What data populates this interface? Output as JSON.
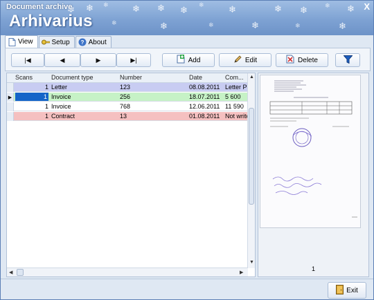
{
  "window": {
    "title": "Document archive",
    "close_glyph": "X",
    "app_name": "Arhivarius"
  },
  "tabs": [
    {
      "label": "View",
      "icon": "document-icon",
      "active": true
    },
    {
      "label": "Setup",
      "icon": "key-icon",
      "active": false
    },
    {
      "label": "About",
      "icon": "help-icon",
      "active": false
    }
  ],
  "toolbar": {
    "nav": {
      "first": "◀◀",
      "prev": "◀",
      "next": "▶",
      "last": "▶▶"
    },
    "add_label": "Add",
    "edit_label": "Edit",
    "delete_label": "Delete"
  },
  "grid": {
    "columns": [
      "Scans",
      "Document type",
      "Number",
      "Date",
      "Com..."
    ],
    "rows": [
      {
        "scans": "1",
        "type": "Letter",
        "number": "123",
        "date": "08.08.2011",
        "comment": "Letter Pi",
        "color": "#c8ccf2",
        "current": false
      },
      {
        "scans": "1",
        "type": "Invoice",
        "number": "256",
        "date": "18.07.2011",
        "comment": "5 600",
        "color": "#c6f2c6",
        "current": true
      },
      {
        "scans": "1",
        "type": "Invoice",
        "number": "768",
        "date": "12.06.2011",
        "comment": "11 590",
        "color": "#ffffff",
        "current": false
      },
      {
        "scans": "1",
        "type": "Contract",
        "number": "13",
        "date": "01.08.2011",
        "comment": "Not write",
        "color": "#f5c0c0",
        "current": false
      }
    ],
    "current_indicator": "▶"
  },
  "preview": {
    "page_number": "1"
  },
  "footer": {
    "exit_label": "Exit"
  },
  "colors": {
    "accent": "#1e5fbf",
    "selected_cell": "#1565c8"
  }
}
